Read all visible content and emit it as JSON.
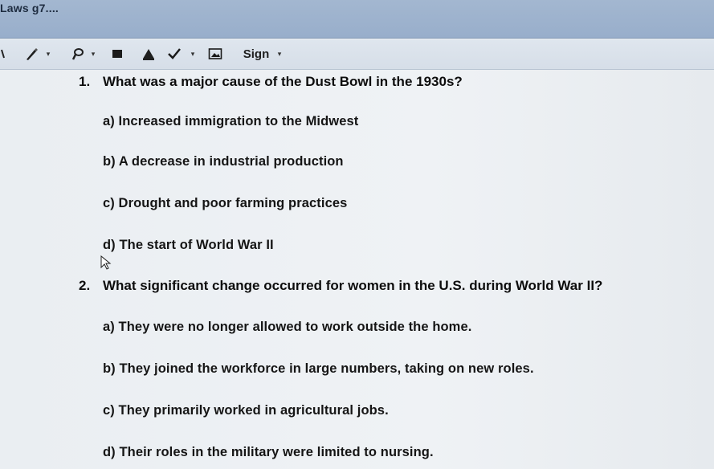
{
  "window": {
    "title": "Laws g7...."
  },
  "toolbar": {
    "sign_label": "Sign",
    "icons": [
      "pen-icon",
      "highlighter-icon",
      "color-swatch-icon",
      "eraser-icon",
      "checkmark-icon",
      "image-icon",
      "chevron-down-icon"
    ]
  },
  "questions": [
    {
      "number": "1.",
      "text": "What was a major cause of the Dust Bowl in the 1930s?",
      "options": [
        "a) Increased immigration to the Midwest",
        "b) A decrease in industrial production",
        "c) Drought and poor farming practices",
        "d) The start of World War II"
      ]
    },
    {
      "number": "2.",
      "text": "What significant change occurred for women in the U.S. during World War II?",
      "options": [
        "a) They were no longer allowed to work outside the home.",
        "b) They joined the workforce in large numbers, taking on new roles.",
        "c) They primarily worked in agricultural jobs.",
        "d) Their roles in the military were limited to nursing."
      ]
    }
  ]
}
